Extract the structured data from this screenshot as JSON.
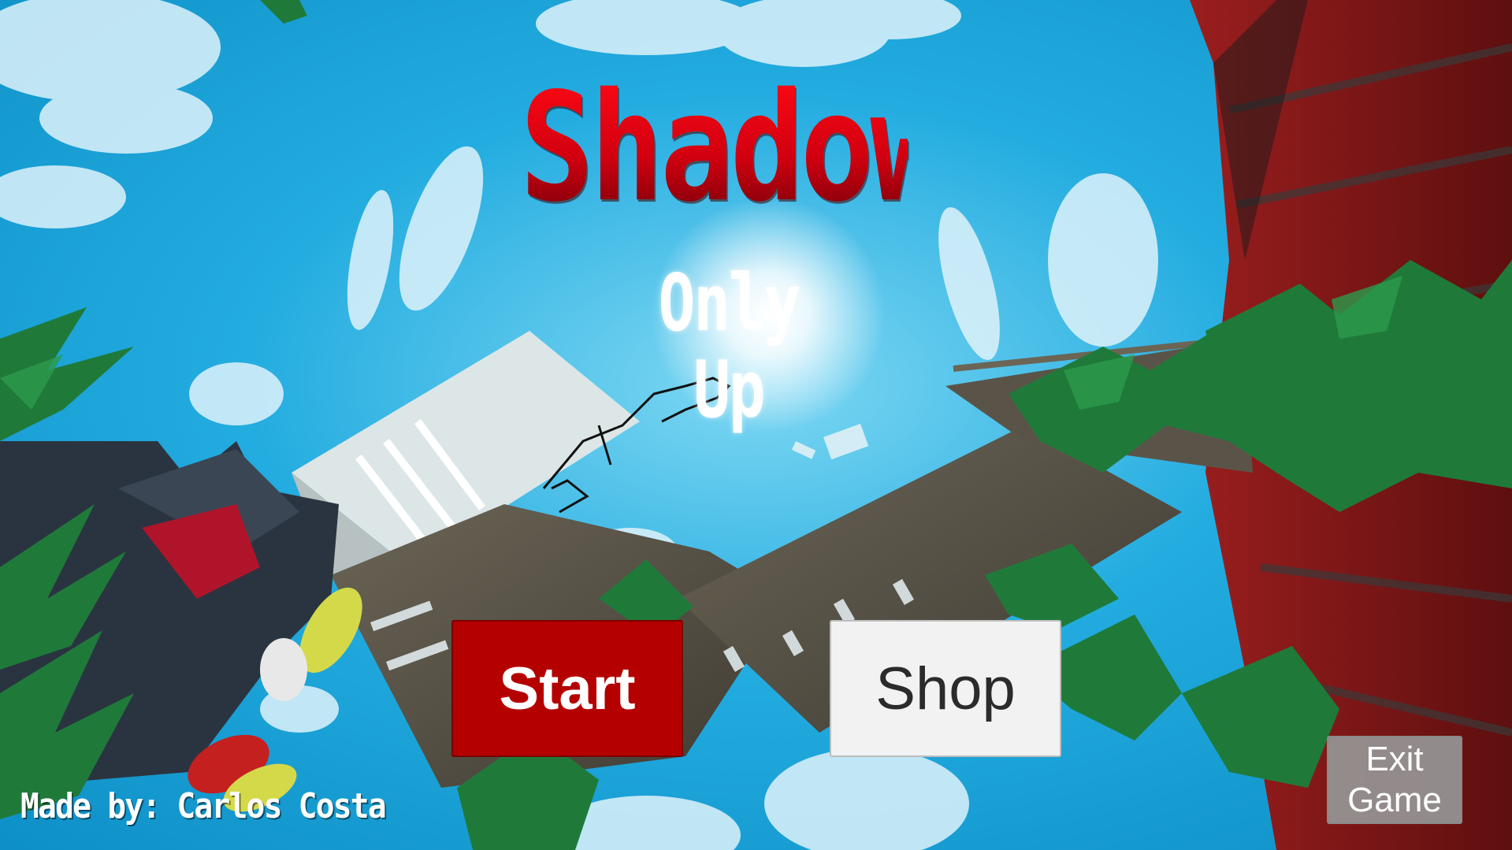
{
  "game": {
    "title": "Shadow",
    "subtitle": "Only Up",
    "credit": "Made by: Carlos Costa"
  },
  "menu": {
    "start_label": "Start",
    "shop_label": "Shop",
    "exit_line1": "Exit",
    "exit_line2": "Game"
  },
  "colors": {
    "sky": "#1aa6d8",
    "title_red": "#e10010",
    "start_button": "#b50000",
    "shop_button": "#f2f2f2",
    "exit_button": "#969696",
    "wood": "#5a5448",
    "foliage": "#1f7a3a",
    "red_building": "#8e1b1b"
  }
}
